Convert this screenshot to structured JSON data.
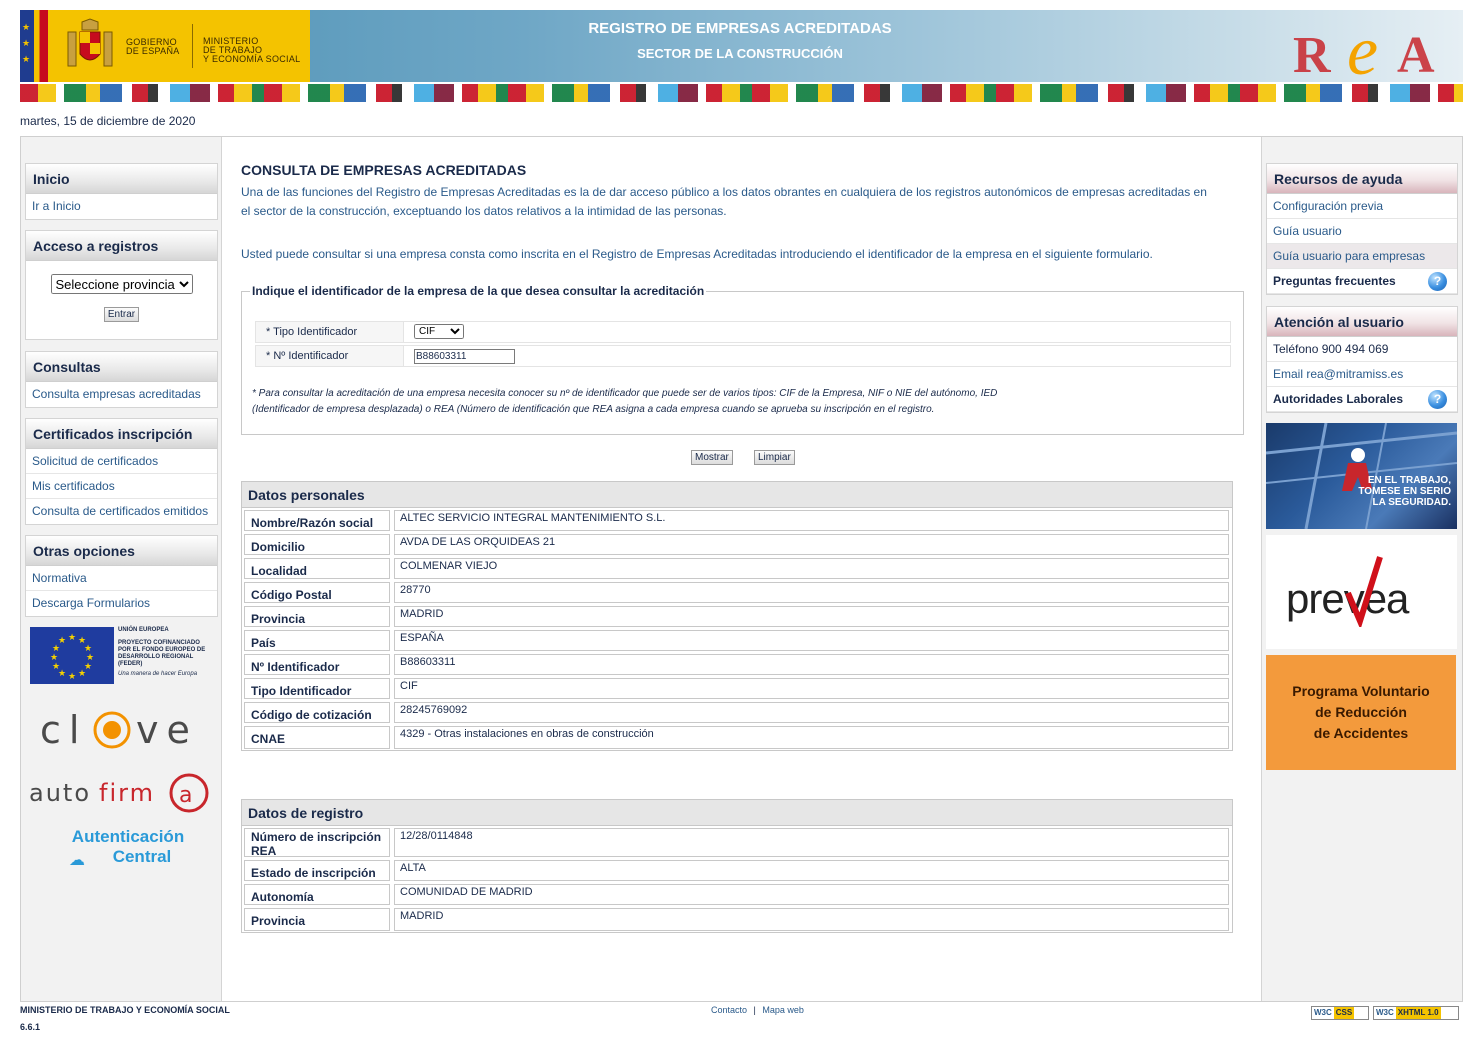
{
  "header": {
    "gov_line1": "GOBIERNO",
    "gov_line2": "DE ESPAÑA",
    "ministry_line1": "MINISTERIO",
    "ministry_line2": "DE TRABAJO",
    "ministry_line3": "Y ECONOMÍA SOCIAL",
    "title": "REGISTRO DE EMPRESAS ACREDITADAS",
    "subtitle": "SECTOR DE LA CONSTRUCCIÓN",
    "logo_text": "REA"
  },
  "date": "martes, 15 de diciembre de 2020",
  "left_menu": {
    "inicio": {
      "title": "Inicio",
      "items": [
        "Ir a Inicio"
      ]
    },
    "acceso": {
      "title": "Acceso a registros",
      "select_value": "Seleccione provincia",
      "button": "Entrar"
    },
    "consultas": {
      "title": "Consultas",
      "items": [
        "Consulta empresas acreditadas"
      ]
    },
    "certificados": {
      "title": "Certificados inscripción",
      "items": [
        "Solicitud de certificados",
        "Mis certificados",
        "Consulta de certificados emitidos"
      ]
    },
    "otras": {
      "title": "Otras opciones",
      "items": [
        "Normativa",
        "Descarga Formularios"
      ]
    },
    "eu_logo": {
      "line1": "UNIÓN EUROPEA",
      "line2": "PROYECTO COFINANCIADO",
      "line3": "POR EL FONDO EUROPEO DE",
      "line4": "DESARROLLO REGIONAL",
      "line5": "(FEDER)",
      "line6": "Una manera de hacer Europa"
    },
    "clave_logo": "cl@ve",
    "autofirma_logo": "autofirm@",
    "autenticacion_line1": "Autenticación",
    "autenticacion_line2": "Central"
  },
  "main": {
    "title": "CONSULTA DE EMPRESAS ACREDITADAS",
    "intro_1": "Una de las funciones del Registro de Empresas Acreditadas es la de dar acceso público a los datos obrantes en cualquiera de los registros autonómicos de empresas acreditadas en",
    "intro_2": "el sector de la construcción, exceptuando los datos relativos a la intimidad de las personas.",
    "intro_3": "Usted puede consultar si una empresa consta como inscrita en el Registro de Empresas Acreditadas introduciendo el identificador de la empresa en el siguiente formulario.",
    "form": {
      "legend": "Indique el identificador de la empresa de la que desea consultar la acreditación",
      "tipo_label": "*  Tipo Identificador",
      "tipo_value": "CIF",
      "num_label": "*  Nº Identificador",
      "num_value": "B88603311",
      "note_1": "*  Para consultar la acreditación de una empresa necesita conocer su nº de identificador que puede ser de varios tipos: CIF de la Empresa, NIF o NIE del autónomo, IED",
      "note_2": "(Identificador de empresa desplazada) o REA (Número de identificación que REA asigna a cada empresa cuando se aprueba su inscripción en el registro.",
      "mostrar": "Mostrar",
      "limpiar": "Limpiar"
    },
    "datos_personales": {
      "title": "Datos personales",
      "rows": [
        {
          "label": "Nombre/Razón social",
          "value": "ALTEC SERVICIO INTEGRAL MANTENIMIENTO S.L."
        },
        {
          "label": "Domicilio",
          "value": "AVDA DE LAS ORQUIDEAS 21"
        },
        {
          "label": "Localidad",
          "value": "COLMENAR VIEJO"
        },
        {
          "label": "Código Postal",
          "value": "28770"
        },
        {
          "label": "Provincia",
          "value": "MADRID"
        },
        {
          "label": "País",
          "value": "ESPAÑA"
        },
        {
          "label": "Nº Identificador",
          "value": "B88603311"
        },
        {
          "label": "Tipo Identificador",
          "value": "CIF"
        },
        {
          "label": "Código de cotización",
          "value": "28245769092"
        },
        {
          "label": "CNAE",
          "value": "4329 - Otras instalaciones en obras de construcción"
        }
      ]
    },
    "datos_registro": {
      "title": "Datos de registro",
      "rows": [
        {
          "label": "Número de inscripción REA",
          "value": "12/28/0114848"
        },
        {
          "label": "Estado de inscripción",
          "value": "ALTA"
        },
        {
          "label": "Autonomía",
          "value": "COMUNIDAD DE MADRID"
        },
        {
          "label": "Provincia",
          "value": "MADRID"
        }
      ]
    }
  },
  "right_menu": {
    "recursos": {
      "title": "Recursos de ayuda",
      "items": [
        "Configuración previa",
        "Guía usuario",
        "Guía usuario para empresas",
        "Preguntas frecuentes"
      ]
    },
    "atencion": {
      "title": "Atención al usuario",
      "items": [
        "Teléfono  900 494 069",
        "Email rea@mitramiss.es",
        "Autoridades Laborales"
      ]
    },
    "banner_safety_1": "EN EL TRABAJO,",
    "banner_safety_2": "TOMESE EN SERIO",
    "banner_safety_3": "LA SEGURIDAD.",
    "prevea": "prevea",
    "programa_1": "Programa Voluntario",
    "programa_2": "de Reducción",
    "programa_3": "de Accidentes"
  },
  "footer": {
    "ministry": "MINISTERIO DE TRABAJO Y ECONOMÍA SOCIAL",
    "version": "6.6.1",
    "contacto": "Contacto",
    "mapa": "Mapa web",
    "w3c_css": "CSS",
    "w3c_xhtml": "XHTML 1.0"
  }
}
